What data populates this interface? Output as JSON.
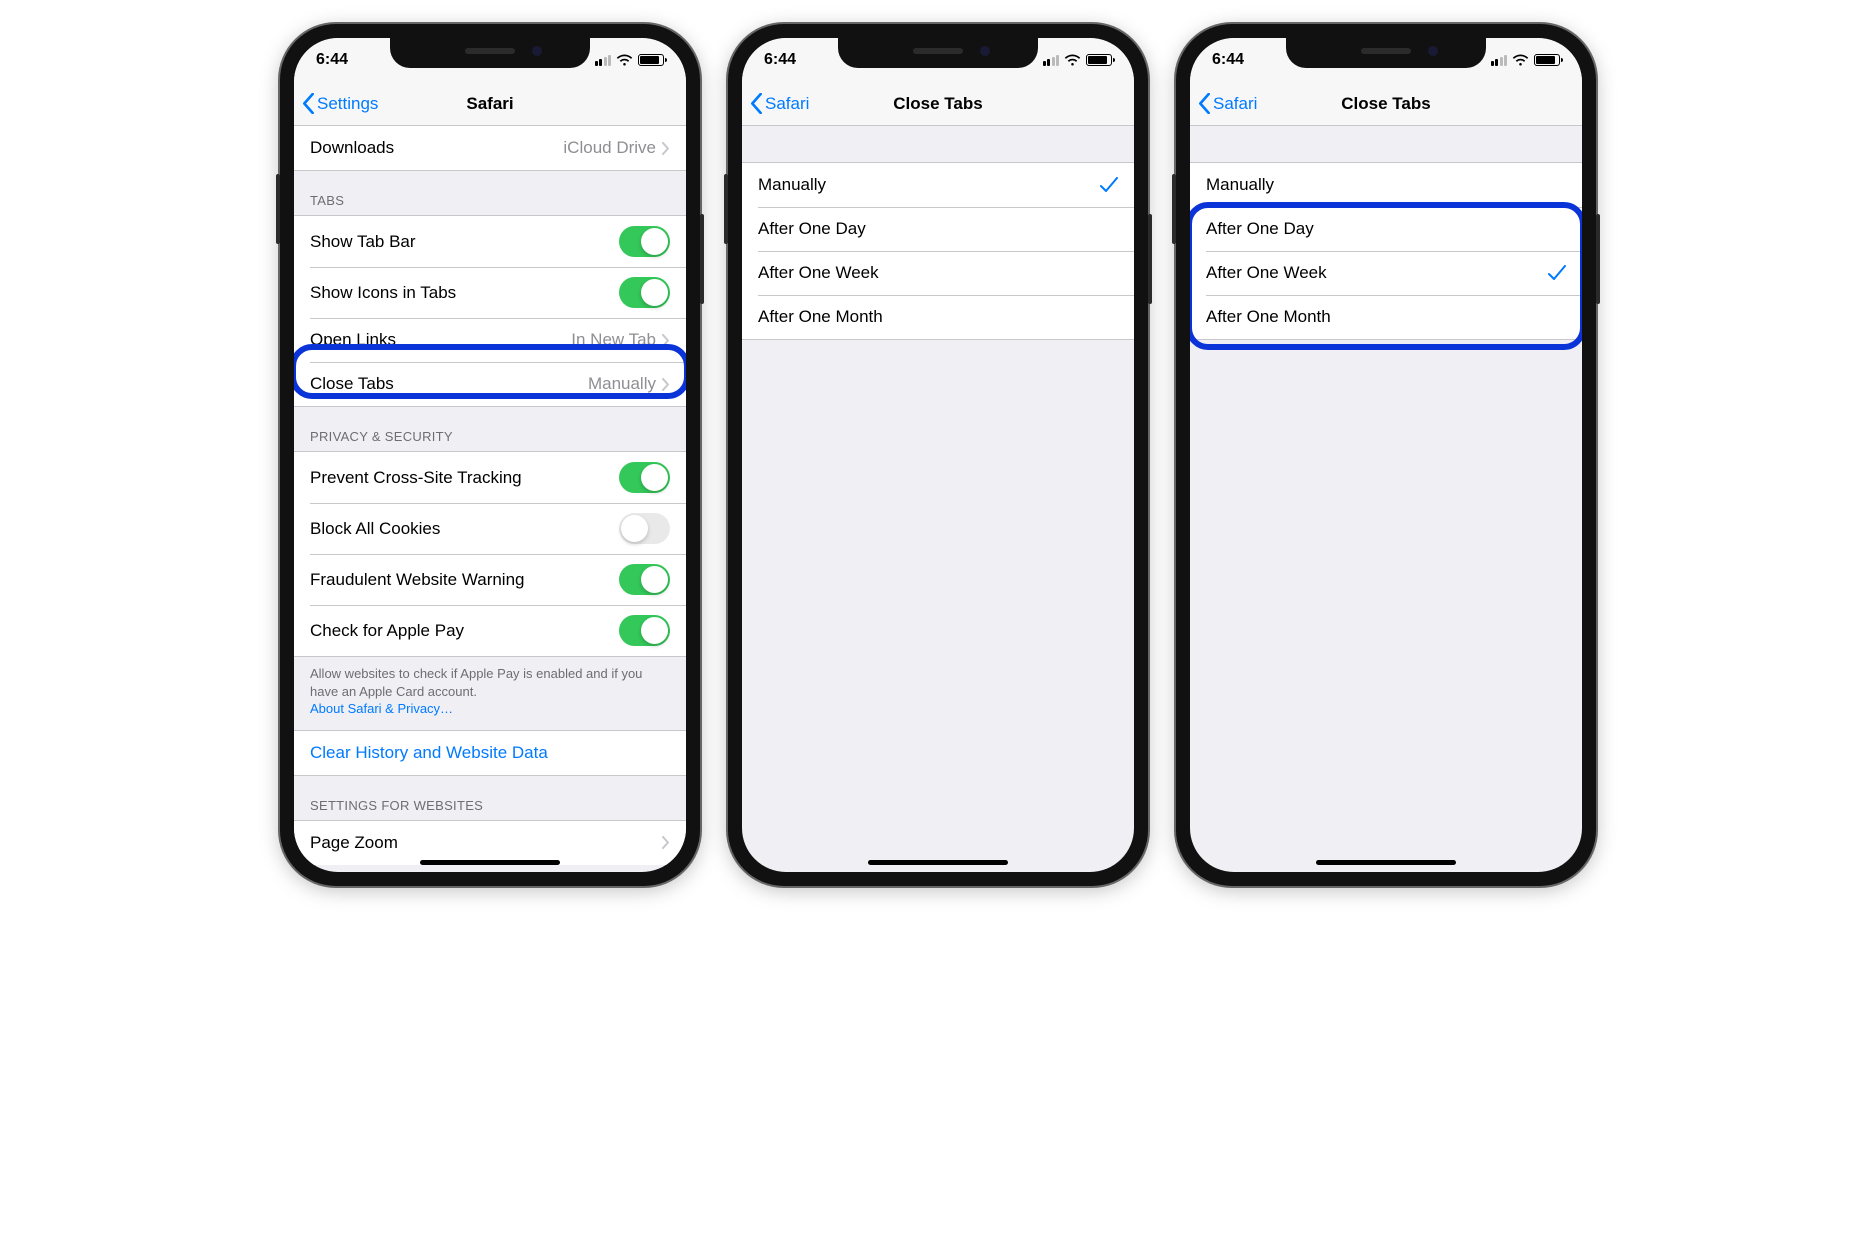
{
  "status": {
    "time": "6:44"
  },
  "colors": {
    "accent": "#007aff",
    "switch_on": "#34c759",
    "highlight": "#0a33d8"
  },
  "phone1": {
    "nav": {
      "back": "Settings",
      "title": "Safari"
    },
    "downloads": {
      "label": "Downloads",
      "value": "iCloud Drive"
    },
    "tabs_section": {
      "header": "TABS",
      "show_tab_bar": {
        "label": "Show Tab Bar",
        "on": true
      },
      "show_icons": {
        "label": "Show Icons in Tabs",
        "on": true
      },
      "open_links": {
        "label": "Open Links",
        "value": "In New Tab"
      },
      "close_tabs": {
        "label": "Close Tabs",
        "value": "Manually"
      }
    },
    "privacy_section": {
      "header": "PRIVACY & SECURITY",
      "prevent_tracking": {
        "label": "Prevent Cross-Site Tracking",
        "on": true
      },
      "block_cookies": {
        "label": "Block All Cookies",
        "on": false
      },
      "fraud_warning": {
        "label": "Fraudulent Website Warning",
        "on": true
      },
      "apple_pay": {
        "label": "Check for Apple Pay",
        "on": true
      },
      "footer_text": "Allow websites to check if Apple Pay is enabled and if you have an Apple Card account.",
      "footer_link": "About Safari & Privacy…"
    },
    "clear_history": {
      "label": "Clear History and Website Data"
    },
    "websites_section": {
      "header": "SETTINGS FOR WEBSITES",
      "page_zoom": {
        "label": "Page Zoom"
      }
    }
  },
  "phone2": {
    "nav": {
      "back": "Safari",
      "title": "Close Tabs"
    },
    "options": [
      {
        "label": "Manually",
        "selected": true
      },
      {
        "label": "After One Day",
        "selected": false
      },
      {
        "label": "After One Week",
        "selected": false
      },
      {
        "label": "After One Month",
        "selected": false
      }
    ]
  },
  "phone3": {
    "nav": {
      "back": "Safari",
      "title": "Close Tabs"
    },
    "options": [
      {
        "label": "Manually",
        "selected": false
      },
      {
        "label": "After One Day",
        "selected": false
      },
      {
        "label": "After One Week",
        "selected": true
      },
      {
        "label": "After One Month",
        "selected": false
      }
    ]
  }
}
